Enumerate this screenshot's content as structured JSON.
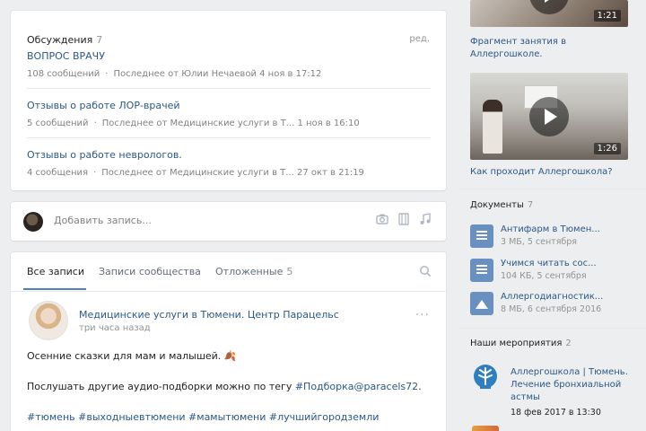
{
  "discussions": {
    "title": "Обсуждения",
    "count": "7",
    "edit_label": "ред.",
    "topics": [
      {
        "title": "ВОПРОС ВРАЧУ",
        "posts": "108 сообщений",
        "last": "Последнее от Юлии Нечаевой 4 ноя в 17:12"
      },
      {
        "title": "Отзывы о работе ЛОР-врачей",
        "posts": "5 сообщений",
        "last": "Последнее от Медицинские услуги в Т... 1 ноя в 16:10"
      },
      {
        "title": "Отзывы о работе неврологов.",
        "posts": "4 сообщения",
        "last": "Последнее от Медицинские услуги в Т... 27 окт в 21:19"
      }
    ]
  },
  "add_post": {
    "placeholder": "Добавить запись..."
  },
  "wall": {
    "tabs": [
      {
        "label": "Все записи",
        "count": ""
      },
      {
        "label": "Записи сообщества",
        "count": ""
      },
      {
        "label": "Отложенные",
        "count": "5"
      }
    ],
    "post": {
      "author": "Медицинские услуги в Тюмени. Центр Парацельс",
      "time": "три часа назад",
      "more": "···",
      "line1": "Осенние сказки для мам и малышей. 🍂",
      "line2_prefix": "Послушать другие аудио-подборки можно по тегу ",
      "line2_tag": "#Подборка@paracels72",
      "line2_suffix": ".",
      "hashtags": "#тюмень #выходныевтюмени #мамытюмени #лучшийгородземли"
    }
  },
  "videos": [
    {
      "duration": "1:21",
      "title": "Фрагмент занятия в Аллергошколе."
    },
    {
      "duration": "1:26",
      "title": "Как проходит Аллергошкола?"
    }
  ],
  "documents": {
    "title": "Документы",
    "count": "7",
    "items": [
      {
        "name": "Антифарм в Тюмен...",
        "meta": "3 МБ, 5 сентября",
        "icon": "doc-icon"
      },
      {
        "name": "Учимся читать сос...",
        "meta": "104 КБ, 5 сентября",
        "icon": "doc-icon"
      },
      {
        "name": "Аллергодиагностик...",
        "meta": "8 МБ, 6 сентября 2016",
        "icon": "image-icon"
      }
    ]
  },
  "events": {
    "title": "Наши мероприятия",
    "count": "2",
    "items": [
      {
        "name": "Аллергошкола | Тюмень. Лечение бронхиальной астмы",
        "date": "18 фев 2017 в 13:30"
      }
    ]
  },
  "colors": {
    "accent": "#5181b8",
    "link": "#2a5885",
    "background": "#edeef0"
  }
}
